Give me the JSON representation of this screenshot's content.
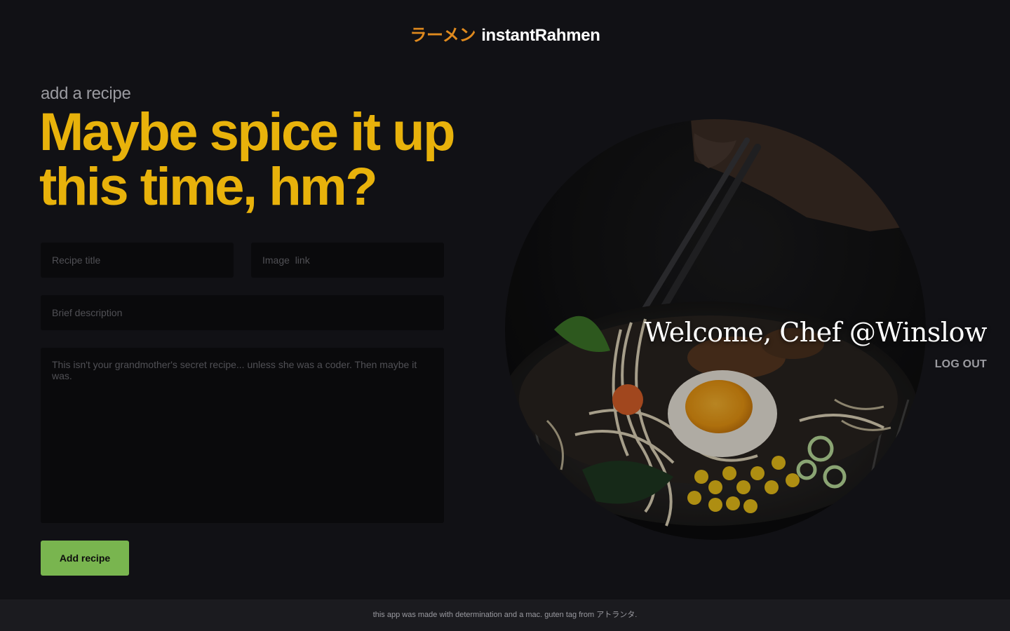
{
  "header": {
    "logo_jp": "ラーメン",
    "logo_name": "instantRahmen"
  },
  "main": {
    "kicker": "add a recipe",
    "headline_line1": "Maybe spice it up",
    "headline_line2": "this time, hm?"
  },
  "form": {
    "recipe_title_placeholder": "Recipe title",
    "image_link_placeholder": "Image  link",
    "description_placeholder": "Brief description",
    "body_placeholder": "This isn't your grandmother's secret recipe... unless she was a coder. Then maybe it was.",
    "submit_label": "Add recipe"
  },
  "user": {
    "welcome": "Welcome, Chef @Winslow",
    "logout_label": "LOG OUT"
  },
  "footer": {
    "text": "this app was made with determination and a mac. guten tag from アトランタ."
  },
  "colors": {
    "background": "#111115",
    "accent_yellow": "#e8b20b",
    "logo_orange": "#e08a1e",
    "button_green": "#79b54f",
    "footer_bg": "#1b1b1f"
  },
  "icons": {
    "hero_image": "ramen-bowl-photo"
  }
}
